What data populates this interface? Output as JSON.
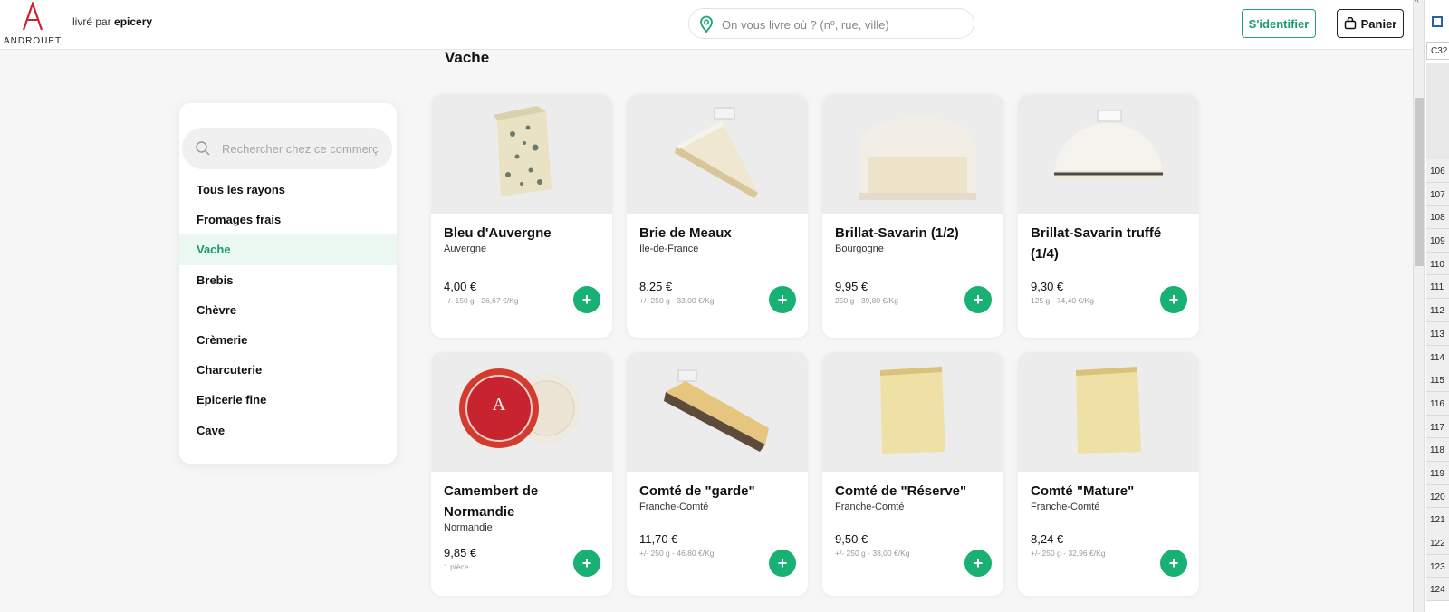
{
  "header": {
    "logo_text": "ANDROUET",
    "delivered_prefix": "livré par",
    "delivered_brand": "epicery",
    "address_placeholder": "On vous livre où ? (nº, rue, ville)",
    "login_label": "S'identifier",
    "cart_label": "Panier"
  },
  "section_title": "Vache",
  "sidebar": {
    "search_placeholder": "Rechercher chez ce commerç",
    "categories": [
      {
        "label": "Tous les rayons"
      },
      {
        "label": "Fromages frais"
      },
      {
        "label": "Vache",
        "active": true
      },
      {
        "label": "Brebis"
      },
      {
        "label": "Chèvre"
      },
      {
        "label": "Crèmerie"
      },
      {
        "label": "Charcuterie"
      },
      {
        "label": "Epicerie fine"
      },
      {
        "label": "Cave"
      }
    ]
  },
  "products": [
    {
      "name": "Bleu d'Auvergne",
      "origin": "Auvergne",
      "price": "4,00 €",
      "info": "+/- 150 g - 26,67 €/Kg",
      "icon": "blue-cheese-icon"
    },
    {
      "name": "Brie de Meaux",
      "origin": "Ile-de-France",
      "price": "8,25 €",
      "info": "+/- 250 g - 33,00 €/Kg",
      "icon": "brie-wedge-icon"
    },
    {
      "name": "Brillat-Savarin (1/2)",
      "origin": "Bourgogne",
      "price": "9,95 €",
      "info": "250 g - 39,80 €/Kg",
      "icon": "brillat-savarin-icon"
    },
    {
      "name": "Brillat-Savarin truffé (1/4)",
      "origin": "",
      "price": "9,30 €",
      "info": "125 g - 74,40 €/Kg",
      "icon": "truffle-cheese-icon"
    },
    {
      "name": "Camembert de Normandie",
      "origin": "Normandie",
      "price": "9,85 €",
      "info": "1 pièce",
      "icon": "camembert-icon"
    },
    {
      "name": "Comté de \"garde\"",
      "origin": "Franche-Comté",
      "price": "11,70 €",
      "info": "+/- 250 g - 46,80 €/Kg",
      "icon": "comte-wedge-icon"
    },
    {
      "name": "Comté de \"Réserve\"",
      "origin": "Franche-Comté",
      "price": "9,50 €",
      "info": "+/- 250 g - 38,00 €/Kg",
      "icon": "comte-block-icon"
    },
    {
      "name": "Comté \"Mature\"",
      "origin": "Franche-Comté",
      "price": "8,24 €",
      "info": "+/- 250 g - 32,96 €/Kg",
      "icon": "comte-block-icon"
    }
  ],
  "excel": {
    "cell_ref": "C32",
    "rows": [
      "106",
      "107",
      "108",
      "109",
      "110",
      "111",
      "112",
      "113",
      "114",
      "115",
      "116",
      "117",
      "118",
      "119",
      "120",
      "121",
      "122",
      "123",
      "124"
    ]
  },
  "colors": {
    "accent": "#19b073",
    "active_bg": "#eaf8f1",
    "brand_red": "#c8242f"
  }
}
